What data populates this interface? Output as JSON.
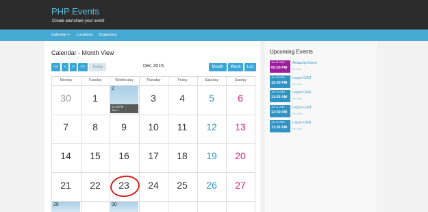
{
  "brand": {
    "title": "PHP Events",
    "tagline": "Create and share your event"
  },
  "nav": {
    "items": [
      {
        "label": "Calendar ▾"
      },
      {
        "label": "Locations"
      },
      {
        "label": "Organizers"
      }
    ]
  },
  "page": {
    "title": "Calendar - Month View"
  },
  "toolbar": {
    "first": "<<",
    "prev": "<",
    "next": ">",
    "last": ">>",
    "today": "Today",
    "month": "Month",
    "week": "Week",
    "list": "List",
    "current_period": "Dec 2015"
  },
  "calendar": {
    "headers": [
      "Monday",
      "Tuesday",
      "Wednesday",
      "Thursday",
      "Friday",
      "Saturday",
      "Sunday"
    ],
    "weeks": [
      [
        "30",
        "1",
        "2",
        "3",
        "4",
        "5",
        "6"
      ],
      [
        "7",
        "8",
        "9",
        "10",
        "11",
        "12",
        "13"
      ],
      [
        "14",
        "15",
        "16",
        "17",
        "18",
        "19",
        "20"
      ],
      [
        "21",
        "22",
        "23",
        "24",
        "25",
        "26",
        "27"
      ],
      [
        "28",
        "",
        "30",
        "",
        "",
        "",
        ""
      ]
    ],
    "event_on_2": {
      "time": "02:20 PM",
      "name": "Test 1"
    }
  },
  "sidebar": {
    "title": "Upcoming Events",
    "events": [
      {
        "date": "Jan 01 2016",
        "time": "00:00 PM",
        "title": "Amazing Event",
        "by": "By user",
        "color": "#9c1e9c"
      },
      {
        "date": "Jan 04 2016",
        "time": "12:30 PM",
        "title": "Leçon G3/4",
        "by": "By chris",
        "color": "#2f94c5"
      },
      {
        "date": "Jan 04 2016",
        "time": "11:30 AM",
        "title": "Leçon G5/6",
        "by": "By chris",
        "color": "#2f94c5"
      },
      {
        "date": "Jan 11 2016",
        "time": "12:30 PM",
        "title": "Leçon G3/4",
        "by": "By chris",
        "color": "#2f94c5"
      },
      {
        "date": "Jan 11 2016",
        "time": "11:30 AM",
        "title": "Leçon G5/6",
        "by": "By chris",
        "color": "#2f94c5"
      }
    ]
  },
  "colors": {
    "accent": "#46a9d4",
    "saturday": "#2f94c5",
    "sunday": "#d2257d",
    "header": "#2c2c2c"
  }
}
